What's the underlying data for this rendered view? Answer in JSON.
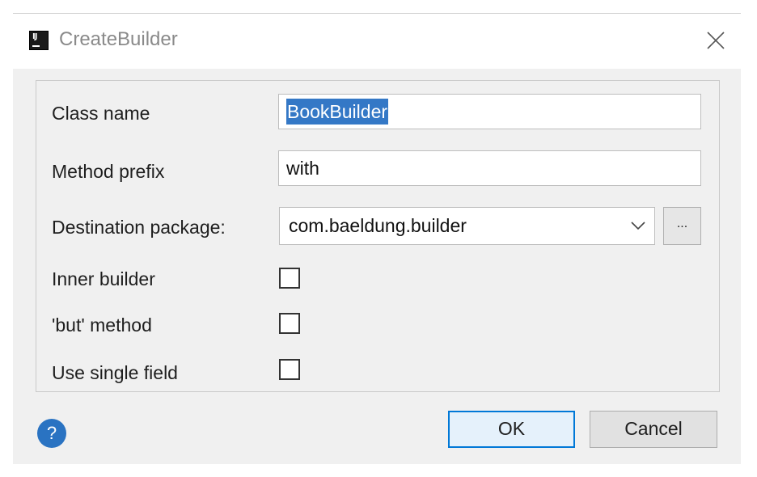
{
  "window": {
    "title": "CreateBuilder",
    "app_icon_text": "IJ"
  },
  "form": {
    "class_name": {
      "label": "Class name",
      "value": "BookBuilder"
    },
    "method_prefix": {
      "label": "Method prefix",
      "value": "with"
    },
    "destination_package": {
      "label": "Destination package:",
      "value": "com.baeldung.builder",
      "browse_label": "..."
    },
    "inner_builder": {
      "label": "Inner builder",
      "checked": false
    },
    "but_method": {
      "label": "'but' method",
      "checked": false
    },
    "use_single_field": {
      "label": "Use single field",
      "checked": false
    }
  },
  "footer": {
    "help_label": "?",
    "ok_label": "OK",
    "cancel_label": "Cancel"
  },
  "colors": {
    "selection": "#3478c6",
    "default_button_border": "#0078d7",
    "help_icon": "#2a73c2"
  }
}
